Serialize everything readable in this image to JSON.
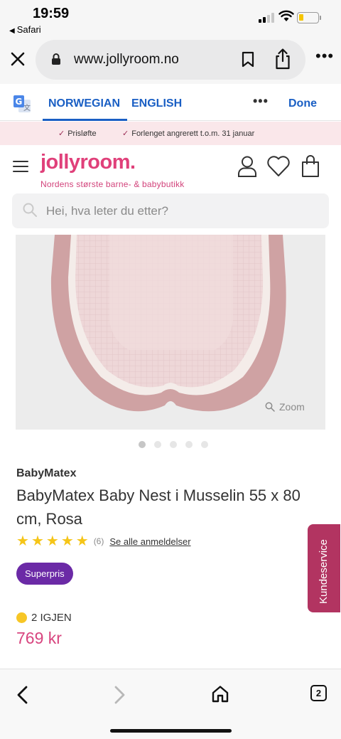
{
  "status_bar": {
    "time": "19:59",
    "back_app": "Safari"
  },
  "browser": {
    "url": "www.jollyroom.no",
    "icons": {
      "close": "close-icon",
      "lock": "lock-icon",
      "bookmark": "bookmark-icon",
      "share": "share-icon",
      "more": "more-icon"
    }
  },
  "translate_bar": {
    "languages": [
      "NORWEGIAN",
      "ENGLISH"
    ],
    "active_language": "NORWEGIAN",
    "more": "•••",
    "done": "Done"
  },
  "promo": {
    "items": [
      "Prisløfte",
      "Forlenget angrerett t.o.m. 31 januar"
    ]
  },
  "header": {
    "logo": "jollyroom.",
    "tagline": "Nordens største barne- & babybutikk"
  },
  "search": {
    "placeholder": "Hei, hva leter du etter?"
  },
  "product": {
    "zoom_label": "Zoom",
    "image_count": 5,
    "active_image": 1,
    "brand": "BabyMatex",
    "title": "BabyMatex Baby Nest i Musselin 55 x 80 cm, Rosa",
    "rating": 5,
    "review_count": "(6)",
    "reviews_link": "Se alle anmeldelser",
    "badge": "Superpris",
    "stock": "2 IGJEN",
    "price": "769 kr"
  },
  "customer_service": {
    "label": "Kundeservice"
  },
  "toolbar": {
    "tabs_count": "2"
  },
  "colors": {
    "brand_pink": "#e0407a",
    "price_pink": "#d8457f",
    "badge_purple": "#6b2aa6",
    "service_tab": "#b23461",
    "star_yellow": "#f5c518",
    "link_blue": "#1a5fc4"
  }
}
